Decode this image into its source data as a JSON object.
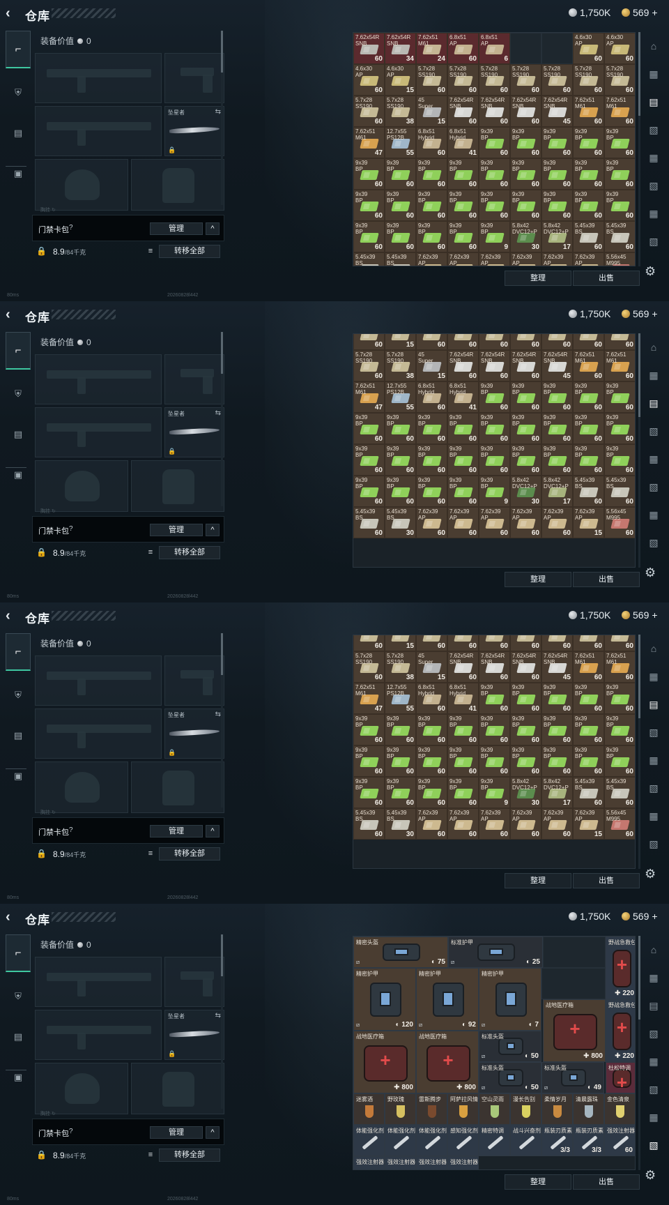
{
  "header": {
    "title": "仓库",
    "currency_silver": "1,750K",
    "currency_gold": "569",
    "currency_gold_plus": "+"
  },
  "equipment": {
    "value_label": "装备价值",
    "value": "0",
    "melee_label": "坠星者",
    "faint_text": "胸挂   ↻",
    "keycard_label": "门禁卡包",
    "help": "?",
    "manage_button": "管理",
    "collapse": "^",
    "weight_current": "8.9",
    "weight_max": "/84千克",
    "list_icon": "≡",
    "move_all_button": "转移全部"
  },
  "status": {
    "ping": "80ms",
    "build_id": "20260828l442"
  },
  "stash_actions": {
    "sort_button": "整理",
    "sell_button": "出售",
    "settings_icon": "⚙"
  },
  "frames": [
    {
      "rows": [
        [
          [
            "7.62x54R\nSNB",
            "60",
            "r",
            "#b9b8b2"
          ],
          [
            "7.62x54R\nSNB",
            "34",
            "r",
            "#b9b8b2"
          ],
          [
            "7.62x51\nM61",
            "24",
            "r",
            "#c5b694"
          ],
          [
            "6.8x51\nAP",
            "60",
            "r",
            "#c3b18f"
          ],
          [
            "6.8x51\nAP",
            "6",
            "r",
            "#c3b18f"
          ],
          [
            "",
            "",
            "e",
            ""
          ],
          [
            "",
            "",
            "e",
            ""
          ],
          [
            "4.6x30\nAP",
            "60",
            "n",
            "#c8b978"
          ],
          [
            "4.6x30\nAP",
            "60",
            "n",
            "#c8b978"
          ]
        ],
        [
          [
            "4.6x30\nAP",
            "60",
            "n",
            "#c8b978"
          ],
          [
            "4.6x30\nAP",
            "15",
            "n",
            "#c8b978"
          ],
          [
            "5.7x28\nSS190",
            "60",
            "n",
            "#c4b995"
          ],
          [
            "5.7x28\nSS190",
            "60",
            "n",
            "#c4b995"
          ],
          [
            "5.7x28\nSS190",
            "60",
            "n",
            "#c4b995"
          ],
          [
            "5.7x28\nSS190",
            "60",
            "n",
            "#c4b995"
          ],
          [
            "5.7x28\nSS190",
            "60",
            "n",
            "#c4b995"
          ],
          [
            "5.7x28\nSS190",
            "60",
            "n",
            "#c4b995"
          ],
          [
            "5.7x28\nSS190",
            "60",
            "n",
            "#c4b995"
          ]
        ],
        [
          [
            "5.7x28\nSS190",
            "60",
            "n",
            "#c4b995"
          ],
          [
            "5.7x28\nSS190",
            "38",
            "n",
            "#c4b995"
          ],
          [
            "45\nSuper",
            "15",
            "n",
            "#b3b5b7"
          ],
          [
            "7.62x54R\nSNB",
            "60",
            "n",
            "#d7d7d4"
          ],
          [
            "7.62x54R\nSNB",
            "60",
            "n",
            "#d7d7d4"
          ],
          [
            "7.62x54R\nSNB",
            "60",
            "n",
            "#d7d7d4"
          ],
          [
            "7.62x54R\nSNB",
            "45",
            "n",
            "#d7d7d4"
          ],
          [
            "7.62x51\nM61",
            "60",
            "n",
            "#d8a14f"
          ],
          [
            "7.62x51\nM61",
            "60",
            "n",
            "#d8a14f"
          ]
        ],
        [
          [
            "7.62x51\nM61",
            "47",
            "n",
            "#d8a14f"
          ],
          [
            "12.7x55\nPS12B",
            "55",
            "n",
            "#9fb6c8"
          ],
          [
            "6.8x51\nHybrid",
            "60",
            "n",
            "#c3b18f"
          ],
          [
            "6.8x51\nHybrid",
            "41",
            "n",
            "#c3b18f"
          ],
          [
            "9x39\nBP",
            "60",
            "n",
            "#8fd05a"
          ],
          [
            "9x39\nBP",
            "60",
            "n",
            "#8fd05a"
          ],
          [
            "9x39\nBP",
            "60",
            "n",
            "#8fd05a"
          ],
          [
            "9x39\nBP",
            "60",
            "n",
            "#8fd05a"
          ],
          [
            "9x39\nBP",
            "60",
            "n",
            "#8fd05a"
          ]
        ],
        [
          [
            "9x39\nBP",
            "60",
            "n",
            "#8fd05a"
          ],
          [
            "9x39\nBP",
            "60",
            "n",
            "#8fd05a"
          ],
          [
            "9x39\nBP",
            "60",
            "n",
            "#8fd05a"
          ],
          [
            "9x39\nBP",
            "60",
            "n",
            "#8fd05a"
          ],
          [
            "9x39\nBP",
            "60",
            "n",
            "#8fd05a"
          ],
          [
            "9x39\nBP",
            "60",
            "n",
            "#8fd05a"
          ],
          [
            "9x39\nBP",
            "60",
            "n",
            "#8fd05a"
          ],
          [
            "9x39\nBP",
            "60",
            "n",
            "#8fd05a"
          ],
          [
            "9x39\nBP",
            "60",
            "n",
            "#8fd05a"
          ]
        ],
        [
          [
            "9x39\nBP",
            "60",
            "n",
            "#8fd05a"
          ],
          [
            "9x39\nBP",
            "60",
            "n",
            "#8fd05a"
          ],
          [
            "9x39\nBP",
            "60",
            "n",
            "#8fd05a"
          ],
          [
            "9x39\nBP",
            "60",
            "n",
            "#8fd05a"
          ],
          [
            "9x39\nBP",
            "60",
            "n",
            "#8fd05a"
          ],
          [
            "9x39\nBP",
            "60",
            "n",
            "#8fd05a"
          ],
          [
            "9x39\nBP",
            "60",
            "n",
            "#8fd05a"
          ],
          [
            "9x39\nBP",
            "60",
            "n",
            "#8fd05a"
          ],
          [
            "9x39\nBP",
            "60",
            "n",
            "#8fd05a"
          ]
        ],
        [
          [
            "9x39\nBP",
            "60",
            "n",
            "#8fd05a"
          ],
          [
            "9x39\nBP",
            "60",
            "n",
            "#8fd05a"
          ],
          [
            "9x39\nBP",
            "60",
            "n",
            "#8fd05a"
          ],
          [
            "9x39\nBP",
            "60",
            "n",
            "#8fd05a"
          ],
          [
            "9x39\nBP",
            "9",
            "n",
            "#8fd05a"
          ],
          [
            "5.8x42\nDVC12+P",
            "30",
            "n",
            "#5b8c4d"
          ],
          [
            "5.8x42\nDVC12+P",
            "17",
            "n",
            "#a7b37d"
          ],
          [
            "5.45x39\nBS",
            "60",
            "n",
            "#c7c5b9"
          ],
          [
            "5.45x39\nBS",
            "60",
            "n",
            "#c7c5b9"
          ]
        ],
        [
          [
            "5.45x39\nBS",
            "60",
            "n",
            "#c7c5b9"
          ],
          [
            "5.45x39\nBS",
            "30",
            "n",
            "#c7c5b9"
          ],
          [
            "7.62x39\nAP",
            "60",
            "n",
            "#cdb98f"
          ],
          [
            "7.62x39\nAP",
            "60",
            "n",
            "#cdb98f"
          ],
          [
            "7.62x39\nAP",
            "60",
            "n",
            "#cdb98f"
          ],
          [
            "7.62x39\nAP",
            "60",
            "n",
            "#cdb98f"
          ],
          [
            "7.62x39\nAP",
            "60",
            "n",
            "#cdb98f"
          ],
          [
            "7.62x39\nAP",
            "15",
            "n",
            "#cdb98f"
          ],
          [
            "5.56x45\nM995",
            "60",
            "n",
            "#c5776f"
          ]
        ]
      ]
    },
    {
      "rows": [
        [
          [
            "",
            "60",
            "n",
            "#c4b995"
          ],
          [
            "",
            "15",
            "n",
            "#c4b995"
          ],
          [
            "",
            "60",
            "n",
            "#c4b995"
          ],
          [
            "",
            "60",
            "n",
            "#c4b995"
          ],
          [
            "",
            "60",
            "n",
            "#c4b995"
          ],
          [
            "",
            "60",
            "n",
            "#c4b995"
          ],
          [
            "",
            "60",
            "n",
            "#c4b995"
          ],
          [
            "",
            "60",
            "n",
            "#c4b995"
          ],
          [
            "",
            "60",
            "n",
            "#c4b995"
          ]
        ],
        [
          [
            "5.7x28\nSS190",
            "60",
            "n",
            "#c4b995"
          ],
          [
            "5.7x28\nSS190",
            "38",
            "n",
            "#c4b995"
          ],
          [
            "45\nSuper",
            "15",
            "n",
            "#b3b5b7"
          ],
          [
            "7.62x54R\nSNB",
            "60",
            "n",
            "#d7d7d4"
          ],
          [
            "7.62x54R\nSNB",
            "60",
            "n",
            "#d7d7d4"
          ],
          [
            "7.62x54R\nSNB",
            "60",
            "n",
            "#d7d7d4"
          ],
          [
            "7.62x54R\nSNB",
            "45",
            "n",
            "#d7d7d4"
          ],
          [
            "7.62x51\nM61",
            "60",
            "n",
            "#d8a14f"
          ],
          [
            "7.62x51\nM61",
            "60",
            "n",
            "#d8a14f"
          ]
        ],
        [
          [
            "7.62x51\nM61",
            "47",
            "n",
            "#d8a14f"
          ],
          [
            "12.7x55\nPS12B",
            "55",
            "n",
            "#9fb6c8"
          ],
          [
            "6.8x51\nHybrid",
            "60",
            "n",
            "#c3b18f"
          ],
          [
            "6.8x51\nHybrid",
            "41",
            "n",
            "#c3b18f"
          ],
          [
            "9x39\nBP",
            "60",
            "n",
            "#8fd05a"
          ],
          [
            "9x39\nBP",
            "60",
            "n",
            "#8fd05a"
          ],
          [
            "9x39\nBP",
            "60",
            "n",
            "#8fd05a"
          ],
          [
            "9x39\nBP",
            "60",
            "n",
            "#8fd05a"
          ],
          [
            "9x39\nBP",
            "60",
            "n",
            "#8fd05a"
          ]
        ],
        [
          [
            "9x39\nBP",
            "60",
            "n",
            "#8fd05a"
          ],
          [
            "9x39\nBP",
            "60",
            "n",
            "#8fd05a"
          ],
          [
            "9x39\nBP",
            "60",
            "n",
            "#8fd05a"
          ],
          [
            "9x39\nBP",
            "60",
            "n",
            "#8fd05a"
          ],
          [
            "9x39\nBP",
            "60",
            "n",
            "#8fd05a"
          ],
          [
            "9x39\nBP",
            "60",
            "n",
            "#8fd05a"
          ],
          [
            "9x39\nBP",
            "60",
            "n",
            "#8fd05a"
          ],
          [
            "9x39\nBP",
            "60",
            "n",
            "#8fd05a"
          ],
          [
            "9x39\nBP",
            "60",
            "n",
            "#8fd05a"
          ]
        ],
        [
          [
            "9x39\nBP",
            "60",
            "n",
            "#8fd05a"
          ],
          [
            "9x39\nBP",
            "60",
            "n",
            "#8fd05a"
          ],
          [
            "9x39\nBP",
            "60",
            "n",
            "#8fd05a"
          ],
          [
            "9x39\nBP",
            "60",
            "n",
            "#8fd05a"
          ],
          [
            "9x39\nBP",
            "60",
            "n",
            "#8fd05a"
          ],
          [
            "9x39\nBP",
            "60",
            "n",
            "#8fd05a"
          ],
          [
            "9x39\nBP",
            "60",
            "n",
            "#8fd05a"
          ],
          [
            "9x39\nBP",
            "60",
            "n",
            "#8fd05a"
          ],
          [
            "9x39\nBP",
            "60",
            "n",
            "#8fd05a"
          ]
        ],
        [
          [
            "9x39\nBP",
            "60",
            "n",
            "#8fd05a"
          ],
          [
            "9x39\nBP",
            "60",
            "n",
            "#8fd05a"
          ],
          [
            "9x39\nBP",
            "60",
            "n",
            "#8fd05a"
          ],
          [
            "9x39\nBP",
            "60",
            "n",
            "#8fd05a"
          ],
          [
            "9x39\nBP",
            "9",
            "n",
            "#8fd05a"
          ],
          [
            "5.8x42\nDVC12+P",
            "30",
            "n",
            "#5b8c4d"
          ],
          [
            "5.8x42\nDVC12+P",
            "17",
            "n",
            "#a7b37d"
          ],
          [
            "5.45x39\nBS",
            "60",
            "n",
            "#c7c5b9"
          ],
          [
            "5.45x39\nBS",
            "60",
            "n",
            "#c7c5b9"
          ]
        ],
        [
          [
            "5.45x39\nBS",
            "60",
            "n",
            "#c7c5b9"
          ],
          [
            "5.45x39\nBS",
            "30",
            "n",
            "#c7c5b9"
          ],
          [
            "7.62x39\nAP",
            "60",
            "n",
            "#cdb98f"
          ],
          [
            "7.62x39\nAP",
            "60",
            "n",
            "#cdb98f"
          ],
          [
            "7.62x39\nAP",
            "60",
            "n",
            "#cdb98f"
          ],
          [
            "7.62x39\nAP",
            "60",
            "n",
            "#cdb98f"
          ],
          [
            "7.62x39\nAP",
            "60",
            "n",
            "#cdb98f"
          ],
          [
            "7.62x39\nAP",
            "15",
            "n",
            "#cdb98f"
          ],
          [
            "5.56x45\nM995",
            "60",
            "n",
            "#c5776f"
          ]
        ]
      ]
    }
  ],
  "gear": {
    "helmet_a": "精密头盔",
    "helmet_a_val": "75",
    "armor_std": "标准护甲",
    "armor_std_val": "25",
    "medbag_top": "野战急救包",
    "medbag_top_val": "220",
    "armor_p1": "精密护甲",
    "armor_p1_val": "120",
    "armor_p2": "精密护甲",
    "armor_p2_val": "92",
    "armor_p3": "精密护甲",
    "armor_p3_val": "7",
    "field_kit_top": "战地医疗箱",
    "field_kit_top_val": "800",
    "medbag_2": "野战急救包",
    "medbag_2_val": "220",
    "field_kit_1": "战地医疗箱",
    "field_kit_1_val": "800",
    "field_kit_2": "战地医疗箱",
    "field_kit_2_val": "800",
    "std_helmet_1": "标准头盔",
    "std_helmet_1_val": "50",
    "std_helmet_2": "标准头盔",
    "std_helmet_2_val": "50",
    "std_helmet_3": "标准头盔",
    "std_helmet_3_val": "49",
    "cocktail": "杜松特调",
    "drinks": [
      "迷雾酒",
      "野玫瑰",
      "雷斯腾步",
      "阿萨拉风情",
      "空山灵雨",
      "漫长告别",
      "柔情岁月",
      "清晨露珠",
      "金色清泉"
    ],
    "injectors": [
      [
        "体能强化剂",
        ""
      ],
      [
        "体能强化剂",
        ""
      ],
      [
        "体能强化剂",
        ""
      ],
      [
        "感知强化剂",
        ""
      ],
      [
        "精密特调",
        ""
      ],
      [
        "战斗兴奋剂",
        ""
      ],
      [
        "瓶装刃质素",
        "3/3"
      ],
      [
        "瓶装刃质素",
        "3/3"
      ],
      [
        "强效注射器",
        "60"
      ]
    ],
    "injectors_bottom": [
      "强效注射器",
      "强效注射器",
      "强效注射器",
      "强效注射器"
    ]
  }
}
